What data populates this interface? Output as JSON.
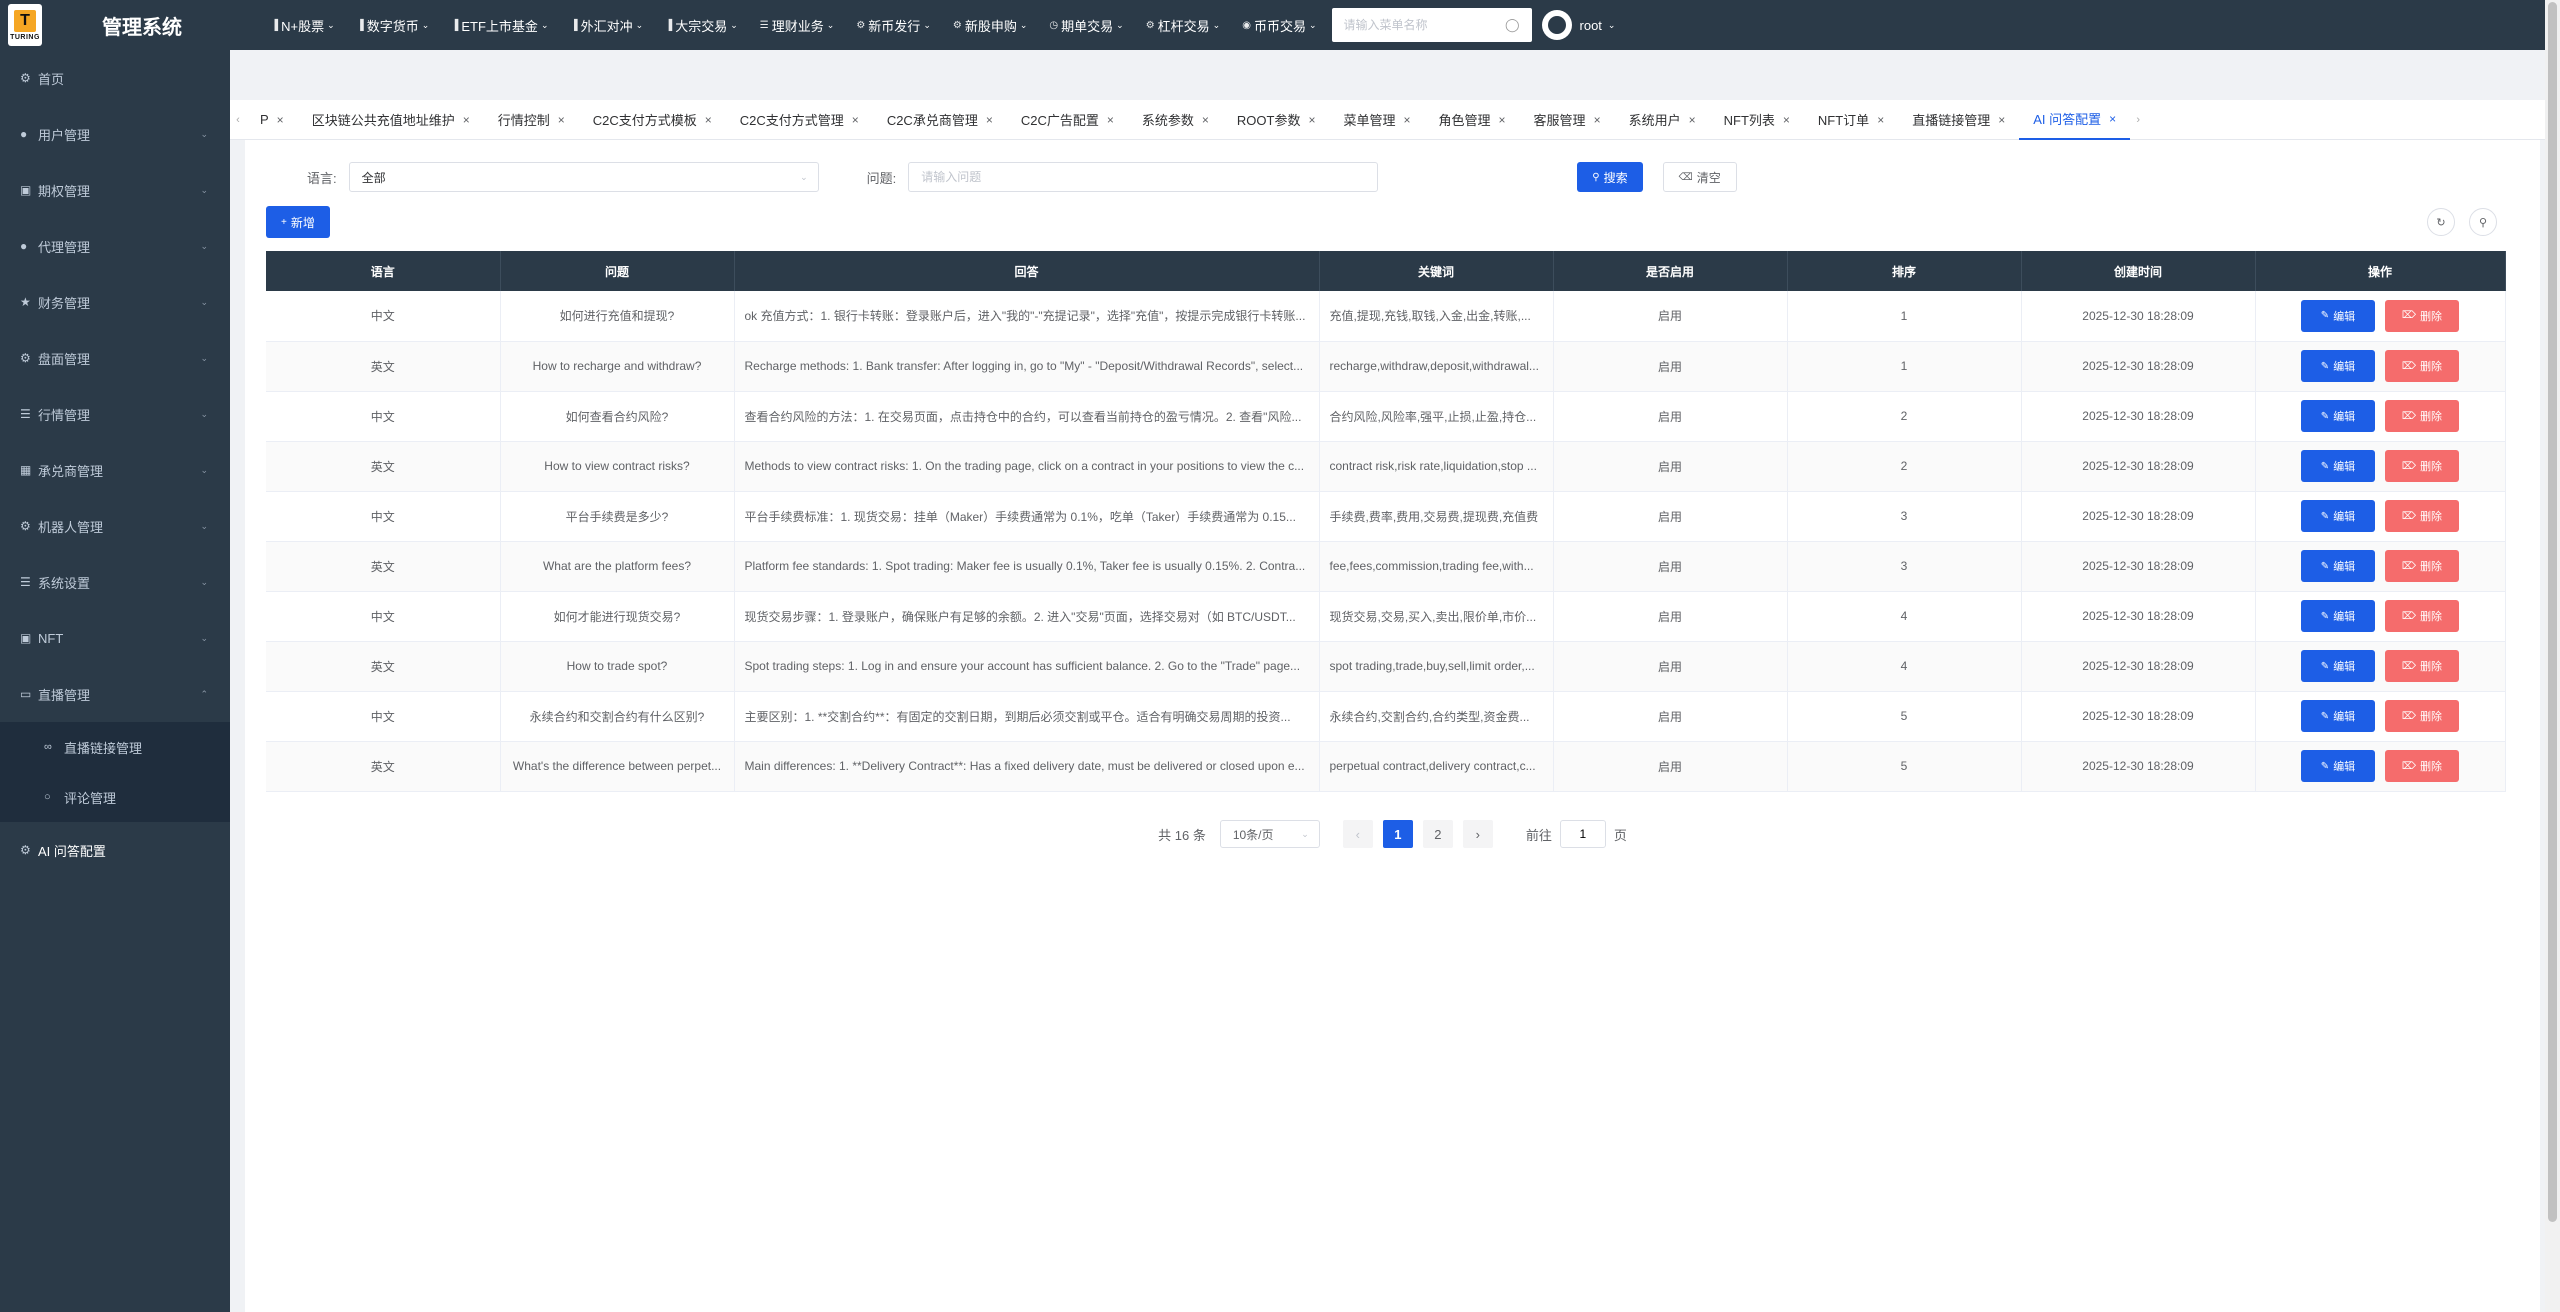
{
  "header": {
    "logo_text": "TURING",
    "system_title": "管理系统",
    "nav": [
      {
        "label": "N+股票",
        "icon": "bar-chart-icon"
      },
      {
        "label": "数字货币",
        "icon": "bar-chart-icon"
      },
      {
        "label": "ETF上市基金",
        "icon": "bar-chart-icon"
      },
      {
        "label": "外汇对冲",
        "icon": "bar-chart-icon"
      },
      {
        "label": "大宗交易",
        "icon": "bar-chart-icon"
      },
      {
        "label": "理财业务",
        "icon": "list-icon"
      },
      {
        "label": "新币发行",
        "icon": "gear-icon"
      },
      {
        "label": "新股申购",
        "icon": "gear-icon"
      },
      {
        "label": "期单交易",
        "icon": "clock-icon"
      },
      {
        "label": "杠杆交易",
        "icon": "gear-icon"
      },
      {
        "label": "币币交易",
        "icon": "pin-icon"
      }
    ],
    "search_placeholder": "请输入菜单名称",
    "user": "root"
  },
  "sidebar": {
    "items": [
      {
        "label": "首页",
        "icon": "gear-icon",
        "has_children": false
      },
      {
        "label": "用户管理",
        "icon": "user-icon",
        "has_children": true
      },
      {
        "label": "期权管理",
        "icon": "chart-icon",
        "has_children": true
      },
      {
        "label": "代理管理",
        "icon": "user-icon",
        "has_children": true
      },
      {
        "label": "财务管理",
        "icon": "star-icon",
        "has_children": true
      },
      {
        "label": "盘面管理",
        "icon": "gear-icon",
        "has_children": true
      },
      {
        "label": "行情管理",
        "icon": "list-icon",
        "has_children": true
      },
      {
        "label": "承兑商管理",
        "icon": "grid-icon",
        "has_children": true
      },
      {
        "label": "机器人管理",
        "icon": "gear-icon",
        "has_children": true
      },
      {
        "label": "系统设置",
        "icon": "list-icon",
        "has_children": true
      },
      {
        "label": "NFT",
        "icon": "chart-icon",
        "has_children": true
      },
      {
        "label": "直播管理",
        "icon": "video-icon",
        "has_children": true,
        "expanded": true
      }
    ],
    "sub_items": [
      {
        "label": "直播链接管理",
        "icon": "link-icon"
      },
      {
        "label": "评论管理",
        "icon": "comment-icon"
      }
    ],
    "last_item": {
      "label": "AI 问答配置",
      "icon": "gear-icon"
    }
  },
  "tabs": [
    {
      "label": "P"
    },
    {
      "label": "区块链公共充值地址维护"
    },
    {
      "label": "行情控制"
    },
    {
      "label": "C2C支付方式模板"
    },
    {
      "label": "C2C支付方式管理"
    },
    {
      "label": "C2C承兑商管理"
    },
    {
      "label": "C2C广告配置"
    },
    {
      "label": "系统参数"
    },
    {
      "label": "ROOT参数"
    },
    {
      "label": "菜单管理"
    },
    {
      "label": "角色管理"
    },
    {
      "label": "客服管理"
    },
    {
      "label": "系统用户"
    },
    {
      "label": "NFT列表"
    },
    {
      "label": "NFT订单"
    },
    {
      "label": "直播链接管理"
    },
    {
      "label": "AI 问答配置",
      "active": true
    }
  ],
  "filters": {
    "lang_label": "语言:",
    "lang_value": "全部",
    "question_label": "问题:",
    "question_placeholder": "请输入问题",
    "search_btn": "搜索",
    "clear_btn": "清空"
  },
  "add_btn": "新增",
  "table": {
    "columns": [
      "语言",
      "问题",
      "回答",
      "关键词",
      "是否启用",
      "排序",
      "创建时间",
      "操作"
    ],
    "edit_label": "编辑",
    "delete_label": "删除",
    "rows": [
      {
        "lang": "中文",
        "q": "如何进行充值和提现?",
        "a": "ok 充值方式：1. 银行卡转账：登录账户后，进入\"我的\"-\"充提记录\"，选择\"充值\"，按提示完成银行卡转账...",
        "kw": "充值,提现,充钱,取钱,入金,出金,转账,...",
        "enabled": "启用",
        "sort": "1",
        "time": "2025-12-30 18:28:09"
      },
      {
        "lang": "英文",
        "q": "How to recharge and withdraw?",
        "a": "Recharge methods: 1. Bank transfer: After logging in, go to \"My\" - \"Deposit/Withdrawal Records\", select...",
        "kw": "recharge,withdraw,deposit,withdrawal...",
        "enabled": "启用",
        "sort": "1",
        "time": "2025-12-30 18:28:09"
      },
      {
        "lang": "中文",
        "q": "如何查看合约风险?",
        "a": "查看合约风险的方法：1. 在交易页面，点击持仓中的合约，可以查看当前持仓的盈亏情况。2. 查看\"风险...",
        "kw": "合约风险,风险率,强平,止损,止盈,持仓...",
        "enabled": "启用",
        "sort": "2",
        "time": "2025-12-30 18:28:09"
      },
      {
        "lang": "英文",
        "q": "How to view contract risks?",
        "a": "Methods to view contract risks: 1. On the trading page, click on a contract in your positions to view the c...",
        "kw": "contract risk,risk rate,liquidation,stop ...",
        "enabled": "启用",
        "sort": "2",
        "time": "2025-12-30 18:28:09"
      },
      {
        "lang": "中文",
        "q": "平台手续费是多少?",
        "a": "平台手续费标准：1. 现货交易：挂单（Maker）手续费通常为 0.1%，吃单（Taker）手续费通常为 0.15...",
        "kw": "手续费,费率,费用,交易费,提现费,充值费",
        "enabled": "启用",
        "sort": "3",
        "time": "2025-12-30 18:28:09"
      },
      {
        "lang": "英文",
        "q": "What are the platform fees?",
        "a": "Platform fee standards: 1. Spot trading: Maker fee is usually 0.1%, Taker fee is usually 0.15%. 2. Contra...",
        "kw": "fee,fees,commission,trading fee,with...",
        "enabled": "启用",
        "sort": "3",
        "time": "2025-12-30 18:28:09"
      },
      {
        "lang": "中文",
        "q": "如何才能进行现货交易?",
        "a": "现货交易步骤：1. 登录账户，确保账户有足够的余额。2. 进入\"交易\"页面，选择交易对（如 BTC/USDT...",
        "kw": "现货交易,交易,买入,卖出,限价单,市价...",
        "enabled": "启用",
        "sort": "4",
        "time": "2025-12-30 18:28:09"
      },
      {
        "lang": "英文",
        "q": "How to trade spot?",
        "a": "Spot trading steps: 1. Log in and ensure your account has sufficient balance. 2. Go to the \"Trade\" page...",
        "kw": "spot trading,trade,buy,sell,limit order,...",
        "enabled": "启用",
        "sort": "4",
        "time": "2025-12-30 18:28:09"
      },
      {
        "lang": "中文",
        "q": "永续合约和交割合约有什么区别?",
        "a": "主要区别：1. **交割合约**：有固定的交割日期，到期后必须交割或平仓。适合有明确交易周期的投资...",
        "kw": "永续合约,交割合约,合约类型,资金费...",
        "enabled": "启用",
        "sort": "5",
        "time": "2025-12-30 18:28:09"
      },
      {
        "lang": "英文",
        "q": "What's the difference between perpet...",
        "a": "Main differences: 1. **Delivery Contract**: Has a fixed delivery date, must be delivered or closed upon e...",
        "kw": "perpetual contract,delivery contract,c...",
        "enabled": "启用",
        "sort": "5",
        "time": "2025-12-30 18:28:09"
      }
    ]
  },
  "pagination": {
    "total": "共 16 条",
    "page_size": "10条/页",
    "pages": [
      "1",
      "2"
    ],
    "current": "1",
    "goto_prefix": "前往",
    "goto_value": "1",
    "goto_suffix": "页"
  }
}
